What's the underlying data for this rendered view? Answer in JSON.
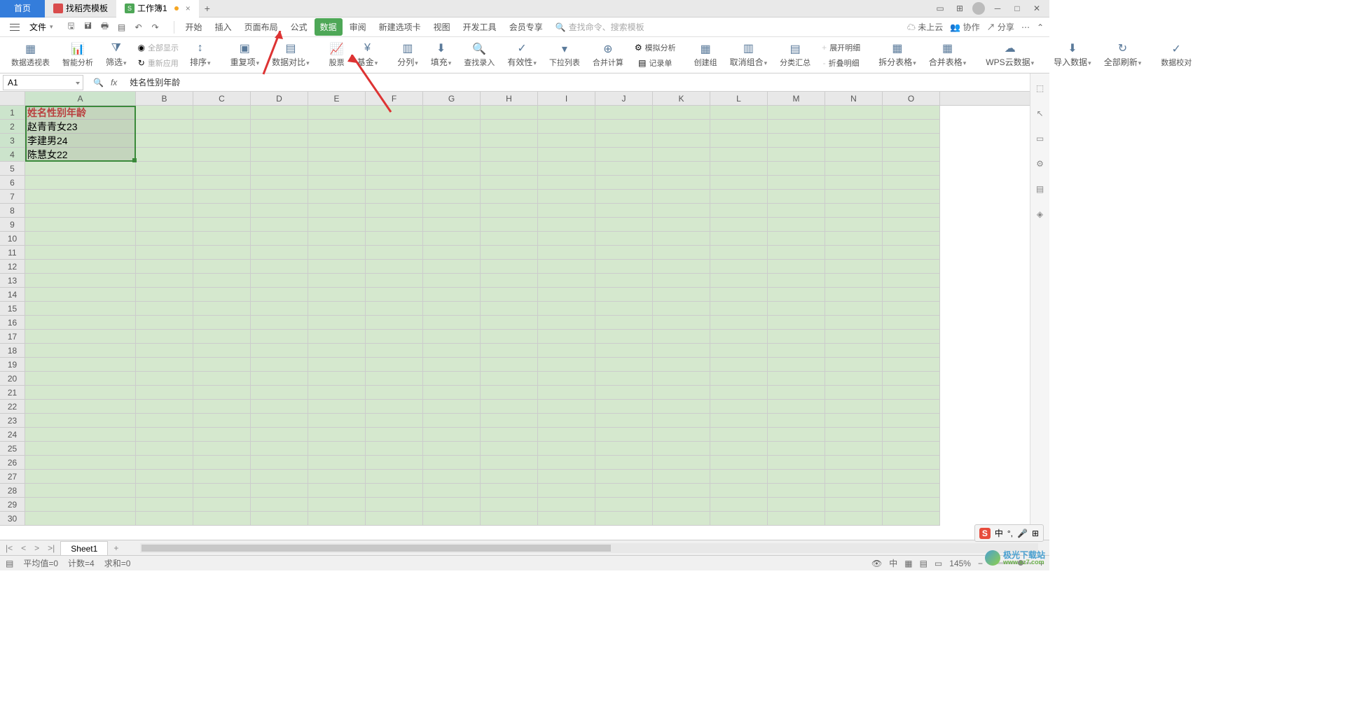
{
  "tabs": {
    "home": "首页",
    "template": "找稻壳模板",
    "workbook": "工作簿1"
  },
  "file_menu": "文件",
  "menu": {
    "start": "开始",
    "insert": "插入",
    "page_layout": "页面布局",
    "formula": "公式",
    "data": "数据",
    "review": "审阅",
    "new_tab": "新建选项卡",
    "view": "视图",
    "dev_tools": "开发工具",
    "member": "会员专享"
  },
  "search_placeholder": "查找命令、搜索模板",
  "top_right": {
    "not_cloud": "未上云",
    "collab": "协作",
    "share": "分享"
  },
  "ribbon": {
    "pivot": "数据透视表",
    "smart": "智能分析",
    "filter": "筛选",
    "show_all": "全部显示",
    "reapply": "重新应用",
    "sort": "排序",
    "dedup": "重复项",
    "compare": "数据对比",
    "stock": "股票",
    "fund": "基金",
    "split": "分列",
    "fill": "填充",
    "find_entry": "查找录入",
    "validity": "有效性",
    "dropdown": "下拉列表",
    "consolidate": "合并计算",
    "simulate": "模拟分析",
    "form": "记录单",
    "group": "创建组",
    "ungroup": "取消组合",
    "subtotal": "分类汇总",
    "expand": "展开明细",
    "collapse": "折叠明细",
    "split_table": "拆分表格",
    "merge_table": "合并表格",
    "wps_cloud": "WPS云数据",
    "import": "导入数据",
    "refresh_all": "全部刷新",
    "data_check": "数据校对"
  },
  "name_box": "A1",
  "formula_content": "姓名性别年龄",
  "columns": [
    "A",
    "B",
    "C",
    "D",
    "E",
    "F",
    "G",
    "H",
    "I",
    "J",
    "K",
    "L",
    "M",
    "N",
    "O"
  ],
  "rows_visible": 30,
  "cells": {
    "A1": "姓名性别年龄",
    "A2": "赵青青女23",
    "A3": "李建男24",
    "A4": "陈慧女22"
  },
  "sheet_nav": {
    "sheet1": "Sheet1"
  },
  "statusbar": {
    "avg": "平均值=0",
    "count": "计数=4",
    "sum": "求和=0",
    "zoom": "145%",
    "lang": "中"
  },
  "ime": {
    "s": "S",
    "lang": "中",
    "dot": "°,",
    "mic": "🎤",
    "grid": "⊞"
  },
  "watermark": {
    "title": "极光下载站",
    "url": "www.xz7.com"
  }
}
